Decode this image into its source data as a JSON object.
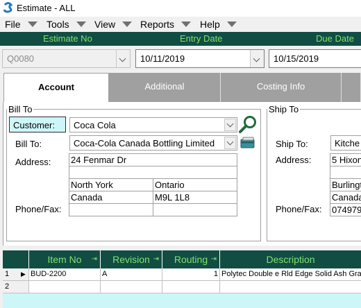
{
  "window": {
    "title": "Estimate - ALL"
  },
  "menu": [
    "File",
    "Tools",
    "View",
    "Reports",
    "Help"
  ],
  "header": {
    "estimate_no": "Estimate No",
    "entry_date": "Entry Date",
    "due_date": "Due Date"
  },
  "fields": {
    "estimate_no": "Q0080",
    "entry_date": "10/11/2019",
    "due_date": "10/15/2019"
  },
  "tabs": [
    "Account",
    "Additional",
    "Costing Info"
  ],
  "bill_to": {
    "legend": "Bill To",
    "customer_label": "Customer:",
    "customer_value": "Coca Cola",
    "bill_to_label": "Bill To:",
    "bill_to_value": "Coca-Cola Canada Bottling Limited",
    "address_label": "Address:",
    "address_line1": "24 Fenmar Dr",
    "address_line2": "",
    "city": "North York",
    "province": "Ontario",
    "country": "Canada",
    "postal": "M9L 1L8",
    "phone_label": "Phone/Fax:",
    "phone": "",
    "fax": ""
  },
  "ship_to": {
    "legend": "Ship To",
    "ship_to_label": "Ship To:",
    "ship_to_value": "Kitche",
    "address_label": "Address:",
    "address_line1": "5 Hixon",
    "city": "Burlingt",
    "country": "Canada",
    "phone_label": "Phone/Fax:",
    "phone": "074979"
  },
  "grid": {
    "columns": [
      "Item No",
      "Revision",
      "Routing",
      "Description"
    ],
    "rows": [
      {
        "num": "1",
        "item_no": "BUD-2200",
        "revision": "A",
        "routing": "1",
        "description": "Polytec Double e Rld Edge Solid Ash Gra"
      },
      {
        "num": "2",
        "item_no": "",
        "revision": "",
        "routing": "",
        "description": ""
      }
    ]
  },
  "icons": {
    "lookup": "magnifier-icon",
    "card": "card-icon"
  },
  "colors": {
    "header_bg": "#124d43",
    "header_text": "#7fe36b",
    "grid_bg": "#cdf6f8"
  }
}
